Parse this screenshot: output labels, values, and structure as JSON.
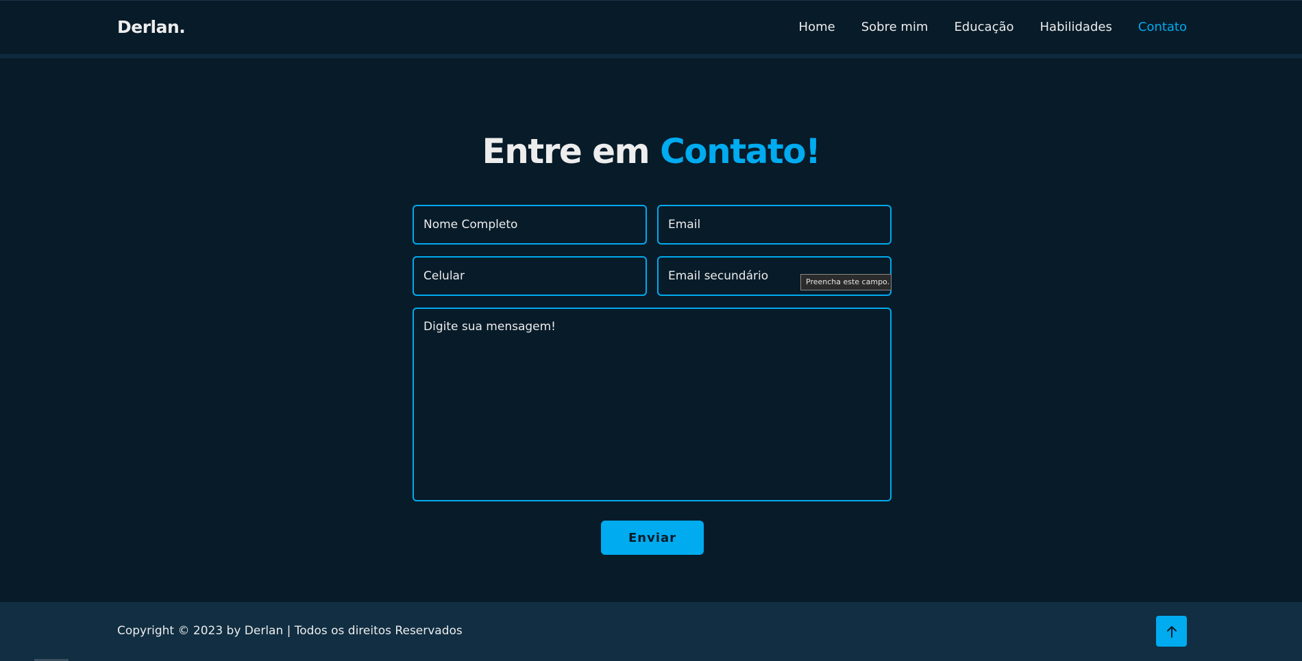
{
  "header": {
    "logo": "Derlan.",
    "nav": [
      {
        "label": "Home",
        "active": false
      },
      {
        "label": "Sobre mim",
        "active": false
      },
      {
        "label": "Educação",
        "active": false
      },
      {
        "label": "Habilidades",
        "active": false
      },
      {
        "label": "Contato",
        "active": true
      }
    ]
  },
  "contact": {
    "title_main": "Entre em ",
    "title_accent": "Contato!",
    "fields": {
      "name_placeholder": "Nome Completo",
      "email_placeholder": "Email",
      "phone_placeholder": "Celular",
      "email2_placeholder": "Email secundário",
      "message_placeholder": "Digite sua mensagem!"
    },
    "tooltip": "Preencha este campo.",
    "submit_label": "Enviar"
  },
  "footer": {
    "copyright": "Copyright © 2023 by Derlan | Todos os direitos Reservados",
    "to_top_icon": "arrow-up-icon"
  },
  "colors": {
    "background": "#081b29",
    "accent": "#00abf0",
    "text": "#ededed",
    "footer_bg": "#112e42"
  }
}
